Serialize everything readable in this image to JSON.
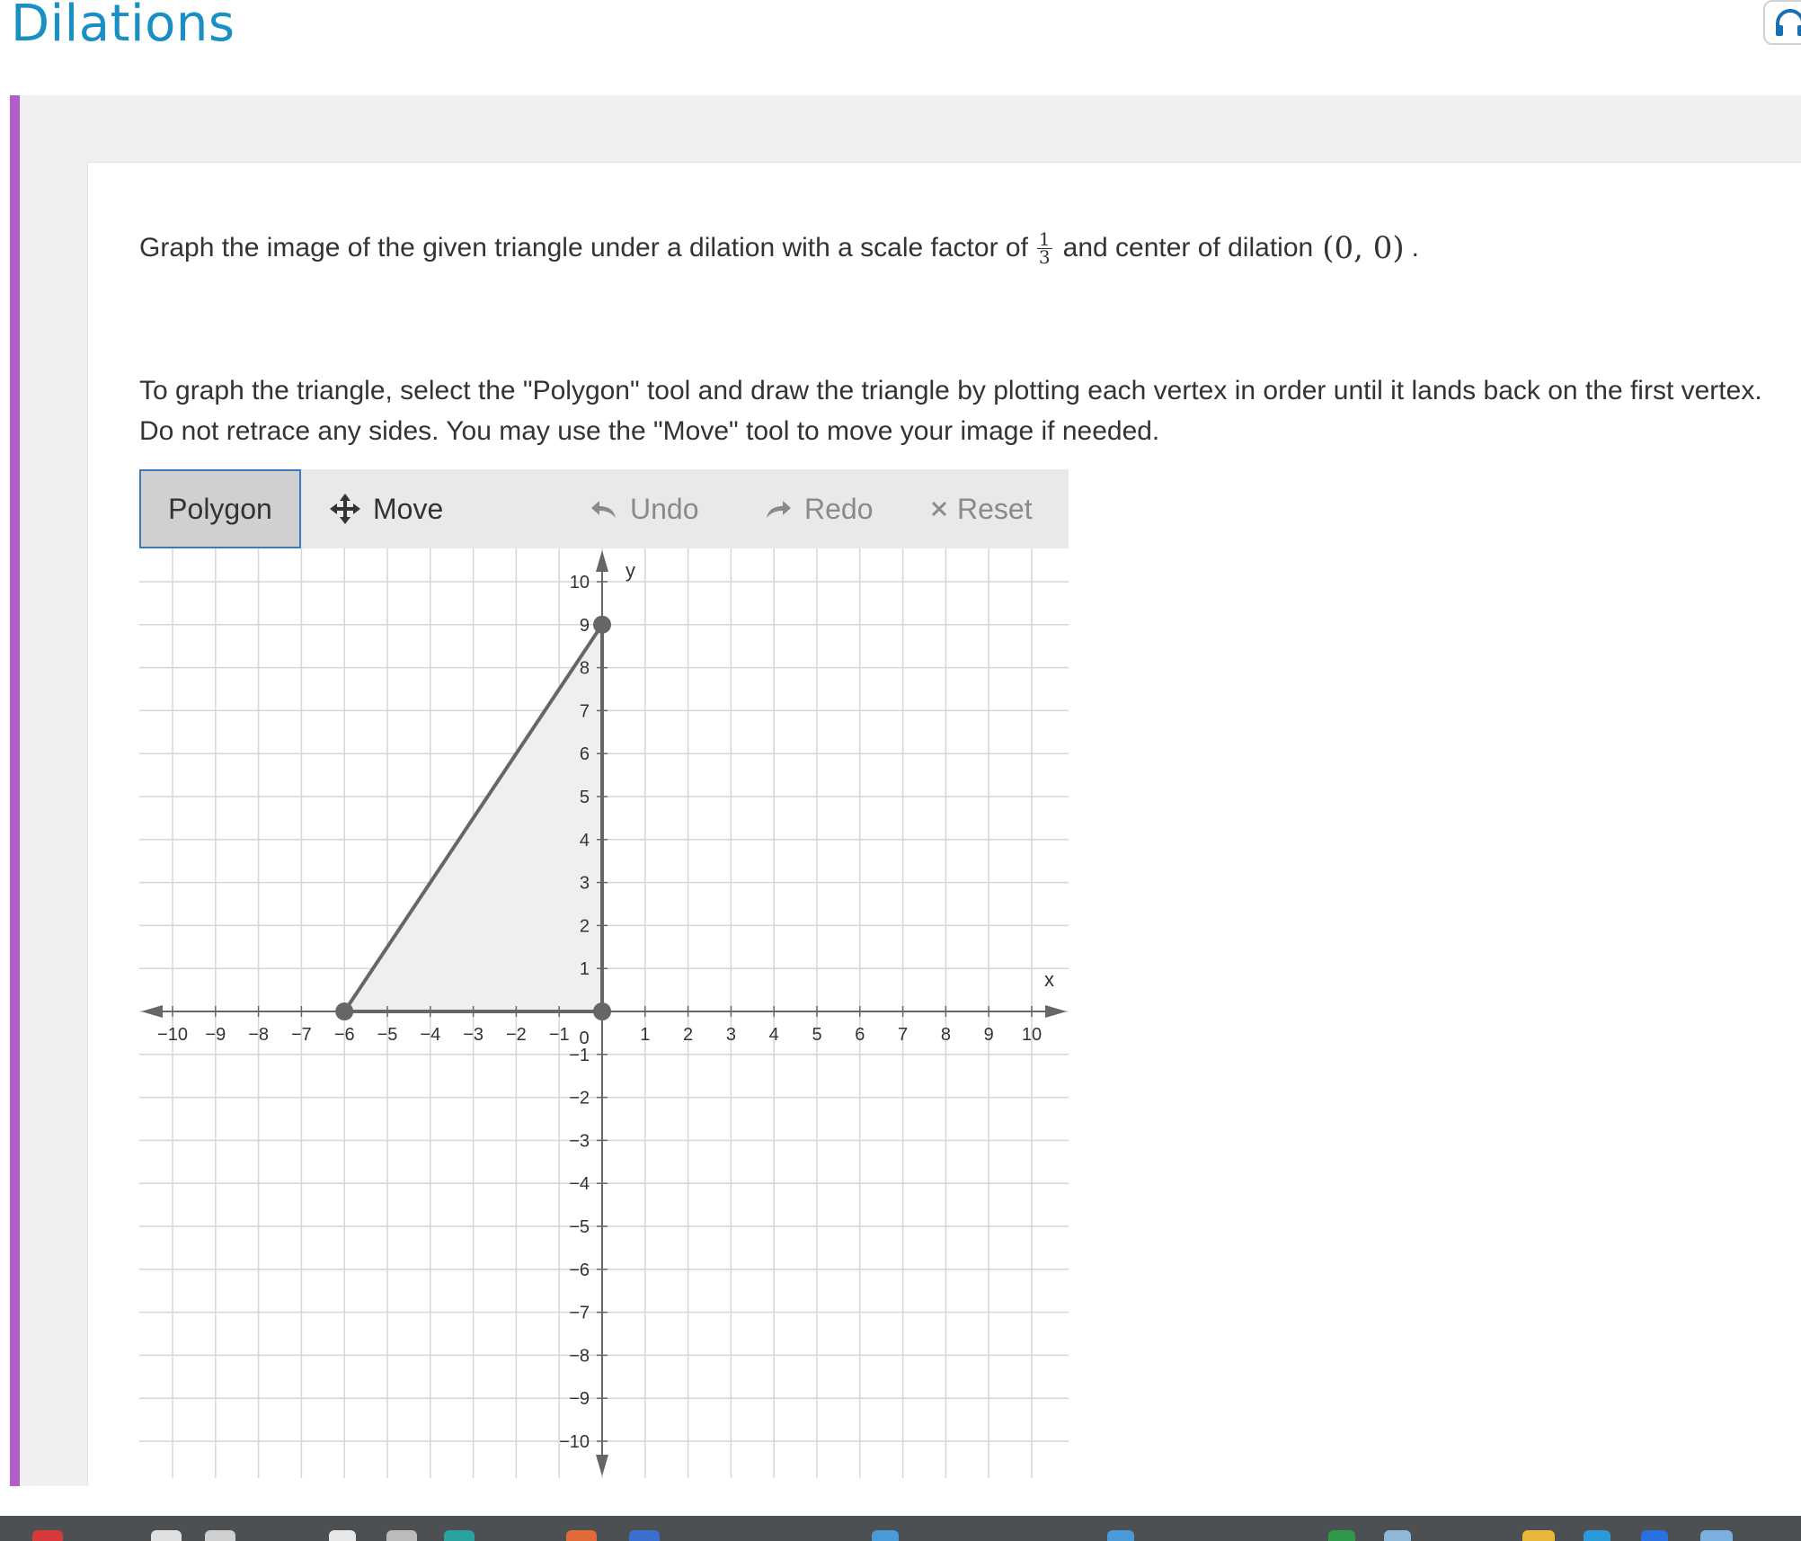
{
  "header": {
    "title": "Dilations",
    "tool_icon": "headphones-icon"
  },
  "question": {
    "prompt_before": "Graph the image of the given triangle under a dilation with a scale factor of",
    "scale_numerator": "1",
    "scale_denominator": "3",
    "prompt_middle": "and center of dilation",
    "center": "(0, 0)",
    "prompt_end": ".",
    "instructions": "To graph the triangle, select the \"Polygon\" tool and draw the triangle by plotting each vertex in order until it lands back on the first vertex. Do not retrace any sides. You may use the \"Move\" tool to move your image if needed."
  },
  "toolbar": {
    "polygon_label": "Polygon",
    "move_label": "Move",
    "undo_label": "Undo",
    "redo_label": "Redo",
    "reset_label": "Reset",
    "move_icon": "move-arrows-icon",
    "undo_icon": "undo-arrow-icon",
    "redo_icon": "redo-arrow-icon",
    "reset_icon": "close-x-icon"
  },
  "chart_data": {
    "type": "scatter",
    "xlabel": "x",
    "ylabel": "y",
    "xlim": [
      -10,
      10
    ],
    "ylim": [
      -10,
      10
    ],
    "grid": true,
    "x_ticks": [
      "−10",
      "−9",
      "−8",
      "−7",
      "−6",
      "−5",
      "−4",
      "−3",
      "−2",
      "−1",
      "0",
      "1",
      "2",
      "3",
      "4",
      "5",
      "6",
      "7",
      "8",
      "9",
      "10"
    ],
    "y_ticks": [
      "−10",
      "−9",
      "−8",
      "−7",
      "−6",
      "−5",
      "−4",
      "−3",
      "−2",
      "−1",
      "1",
      "2",
      "3",
      "4",
      "5",
      "6",
      "7",
      "8",
      "9",
      "10"
    ],
    "polygon": {
      "vertices": [
        [
          0,
          9
        ],
        [
          -6,
          0
        ],
        [
          0,
          0
        ]
      ],
      "fill": "#efefef",
      "stroke": "#666666"
    }
  },
  "colors": {
    "title": "#1a8fc4",
    "accent_border": "#b05ec8",
    "active_tool_border": "#3a7bbd",
    "grid": "#d6d6d6",
    "axis": "#666666",
    "vertex": "#666666"
  }
}
